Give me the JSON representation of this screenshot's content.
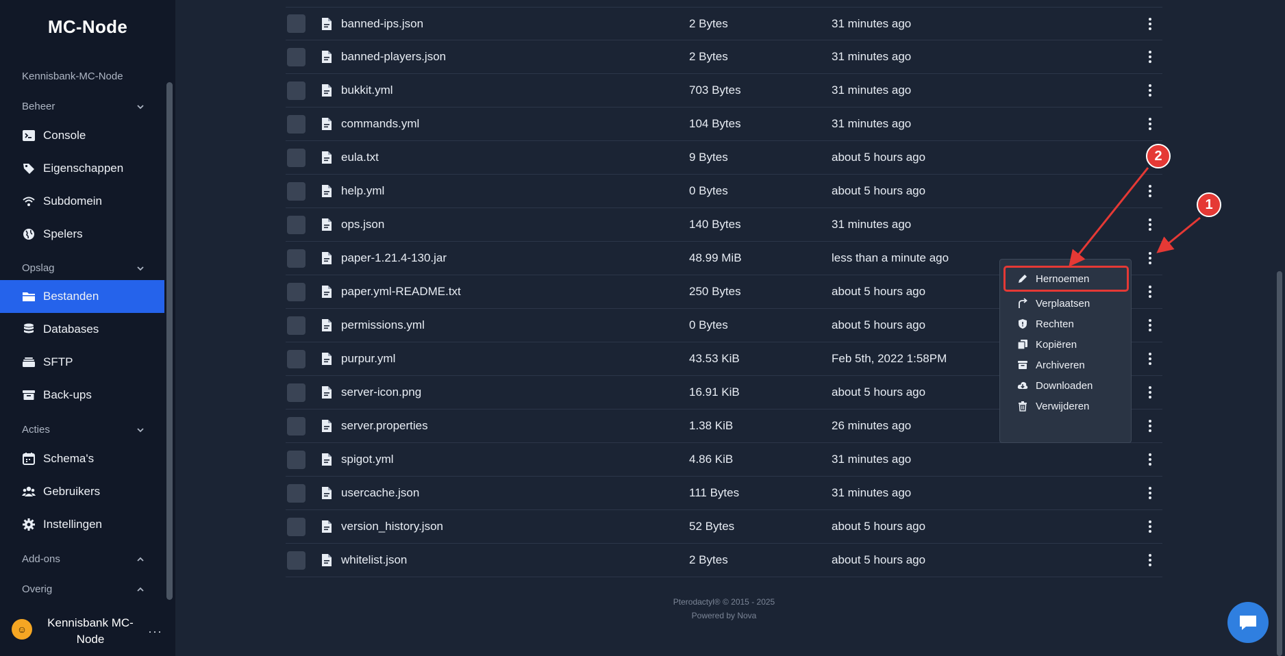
{
  "sidebar": {
    "brand": "MC-Node",
    "server_name": "Kennisbank-MC-Node",
    "sections": {
      "beheer": "Beheer",
      "opslag": "Opslag",
      "acties": "Acties",
      "addons": "Add-ons",
      "overig": "Overig"
    },
    "items": {
      "console": "Console",
      "eigenschappen": "Eigenschappen",
      "subdomein": "Subdomein",
      "spelers": "Spelers",
      "bestanden": "Bestanden",
      "databases": "Databases",
      "sftp": "SFTP",
      "backups": "Back-ups",
      "schemas": "Schema's",
      "gebruikers": "Gebruikers",
      "instellingen": "Instellingen"
    },
    "user": {
      "name": "Kennisbank MC-Node",
      "more": "···"
    }
  },
  "files": [
    {
      "name": "banned-ips.json",
      "size": "2 Bytes",
      "modified": "31 minutes ago"
    },
    {
      "name": "banned-players.json",
      "size": "2 Bytes",
      "modified": "31 minutes ago"
    },
    {
      "name": "bukkit.yml",
      "size": "703 Bytes",
      "modified": "31 minutes ago"
    },
    {
      "name": "commands.yml",
      "size": "104 Bytes",
      "modified": "31 minutes ago"
    },
    {
      "name": "eula.txt",
      "size": "9 Bytes",
      "modified": "about 5 hours ago"
    },
    {
      "name": "help.yml",
      "size": "0 Bytes",
      "modified": "about 5 hours ago"
    },
    {
      "name": "ops.json",
      "size": "140 Bytes",
      "modified": "31 minutes ago"
    },
    {
      "name": "paper-1.21.4-130.jar",
      "size": "48.99 MiB",
      "modified": "less than a minute ago"
    },
    {
      "name": "paper.yml-README.txt",
      "size": "250 Bytes",
      "modified": "about 5 hours ago"
    },
    {
      "name": "permissions.yml",
      "size": "0 Bytes",
      "modified": "about 5 hours ago"
    },
    {
      "name": "purpur.yml",
      "size": "43.53 KiB",
      "modified": "Feb 5th, 2022 1:58PM"
    },
    {
      "name": "server-icon.png",
      "size": "16.91 KiB",
      "modified": "about 5 hours ago"
    },
    {
      "name": "server.properties",
      "size": "1.38 KiB",
      "modified": "26 minutes ago"
    },
    {
      "name": "spigot.yml",
      "size": "4.86 KiB",
      "modified": "31 minutes ago"
    },
    {
      "name": "usercache.json",
      "size": "111 Bytes",
      "modified": "31 minutes ago"
    },
    {
      "name": "version_history.json",
      "size": "52 Bytes",
      "modified": "about 5 hours ago"
    },
    {
      "name": "whitelist.json",
      "size": "2 Bytes",
      "modified": "about 5 hours ago"
    }
  ],
  "context_menu": {
    "rename": "Hernoemen",
    "move": "Verplaatsen",
    "permissions": "Rechten",
    "copy": "Kopiëren",
    "archive": "Archiveren",
    "download": "Downloaden",
    "delete": "Verwijderen"
  },
  "footer": {
    "copyright": "Pterodactyl® © 2015 - 2025",
    "powered": "Powered by Nova"
  },
  "annotations": {
    "badge1": "1",
    "badge2": "2"
  },
  "colors": {
    "accent": "#2563eb",
    "annotation": "#e53935",
    "background": "#1b2434",
    "sidebar": "#111827"
  }
}
